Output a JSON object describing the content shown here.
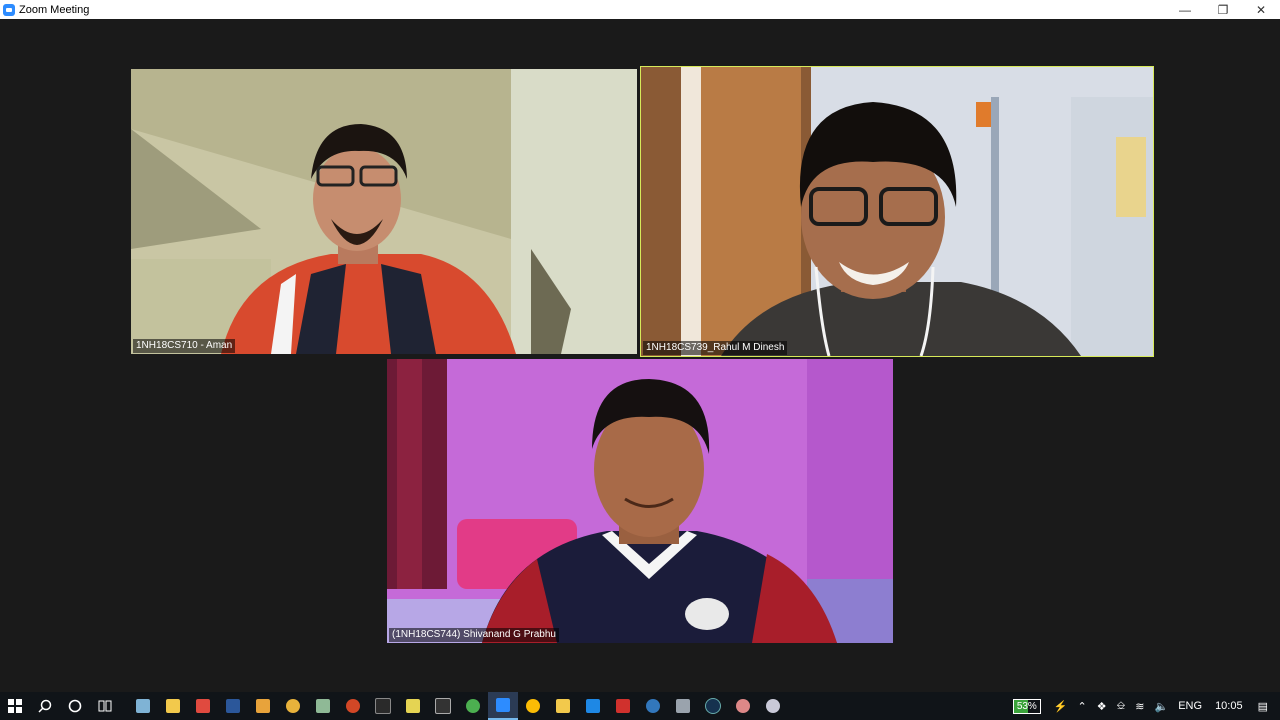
{
  "window": {
    "title": "Zoom Meeting"
  },
  "participants": [
    {
      "name": "1NH18CS710 - Aman",
      "active": false
    },
    {
      "name": "1NH18CS739_Rahul M Dinesh",
      "active": true
    },
    {
      "name": "(1NH18CS744) Shivanand G Prabhu",
      "active": false
    }
  ],
  "taskbar": {
    "apps": [
      "start-icon",
      "search-icon",
      "cortana-icon",
      "task-view-icon",
      "app-icon",
      "file-explorer-icon",
      "app-icon",
      "word-icon",
      "app-icon",
      "chrome-icon",
      "app-icon",
      "powerpoint-icon",
      "terminal-icon",
      "app-icon",
      "cmd-icon",
      "chrome-icon",
      "zoom-icon",
      "chrome-icon",
      "file-explorer-icon",
      "vscode-icon",
      "app-icon",
      "edge-icon",
      "app-icon",
      "app-icon",
      "app-icon",
      "settings-icon"
    ],
    "tray": {
      "battery_percent": "53%",
      "language": "ENG",
      "time": "10:05"
    }
  },
  "colors": {
    "active_speaker": "#d7ea5a",
    "accent": "#2d8cff"
  }
}
